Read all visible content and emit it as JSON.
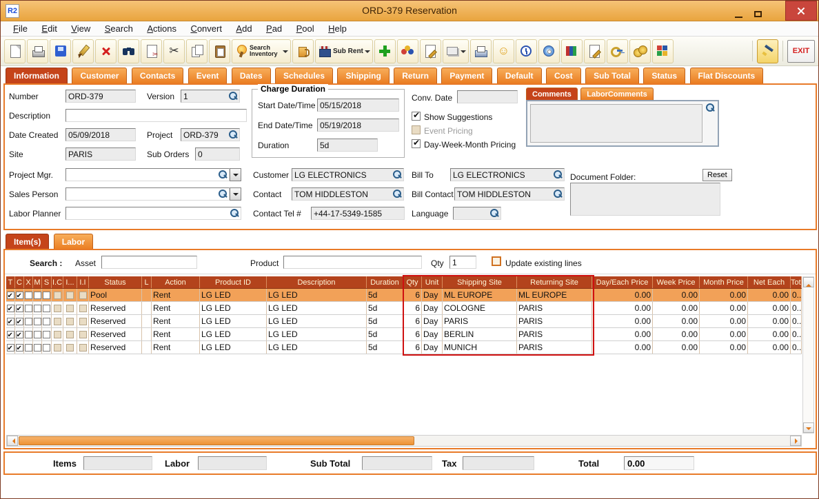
{
  "window": {
    "title": "ORD-379 Reservation",
    "app_initials": "R2"
  },
  "menu": {
    "items": [
      "File",
      "Edit",
      "View",
      "Search",
      "Actions",
      "Convert",
      "Add",
      "Pad",
      "Pool",
      "Help"
    ]
  },
  "toolbar": {
    "search_inventory": "Search Inventory",
    "sub_rent": "Sub Rent",
    "exit": "EXIT"
  },
  "icons": {
    "scissors": "✂",
    "smiley": "☺"
  },
  "tabs": [
    "Information",
    "Customer",
    "Contacts",
    "Event",
    "Dates",
    "Schedules",
    "Shipping",
    "Return",
    "Payment",
    "Default",
    "Cost",
    "Sub Total",
    "Status",
    "Flat Discounts"
  ],
  "info": {
    "labels": {
      "number": "Number",
      "version": "Version",
      "description": "Description",
      "date_created": "Date Created",
      "project": "Project",
      "site": "Site",
      "sub_orders": "Sub Orders",
      "project_mgr": "Project Mgr.",
      "sales_person": "Sales Person",
      "labor_planner": "Labor Planner",
      "charge_duration": "Charge Duration",
      "start": "Start Date/Time",
      "end": "End Date/Time",
      "duration": "Duration",
      "conv_date": "Conv. Date",
      "show_suggestions": "Show Suggestions",
      "event_pricing": "Event Pricing",
      "dwm_pricing": "Day-Week-Month Pricing",
      "customer": "Customer",
      "bill_to": "Bill To",
      "contact": "Contact",
      "bill_contact": "Bill Contact",
      "contact_tel": "Contact Tel #",
      "language": "Language",
      "document_folder": "Document Folder:",
      "reset": "Reset"
    },
    "values": {
      "number": "ORD-379",
      "version": "1",
      "description": "",
      "date_created": "05/09/2018",
      "project": "ORD-379",
      "site": "PARIS",
      "sub_orders": "0",
      "start": "05/15/2018",
      "end": "05/19/2018",
      "duration": "5d",
      "conv_date": "",
      "customer": "LG ELECTRONICS",
      "bill_to": "LG ELECTRONICS",
      "contact": "TOM HIDDLESTON",
      "bill_contact": "TOM HIDDLESTON",
      "contact_tel": "+44-17-5349-1585",
      "language": ""
    },
    "comments_tabs": [
      "Comments",
      "LaborComments"
    ]
  },
  "items": {
    "tabs": [
      "Item(s)",
      "Labor"
    ],
    "search_label": "Search :",
    "asset_label": "Asset",
    "product_label": "Product",
    "qty_label": "Qty",
    "qty_value": "1",
    "update_label": "Update existing lines"
  },
  "grid": {
    "columns": [
      "T",
      "C",
      "X",
      "M",
      "S",
      "I.C",
      "I...",
      "I.I",
      "Status",
      "L",
      "Action",
      "Product ID",
      "Description",
      "Duration",
      "Qty",
      "Unit",
      "Shipping Site",
      "Returning Site",
      "Day/Each Price",
      "Week Price",
      "Month Price",
      "Net Each",
      "Tot..."
    ],
    "rows": [
      {
        "status": "Pool",
        "action": "Rent",
        "product_id": "LG LED",
        "description": "LG LED",
        "duration": "5d",
        "qty": "6",
        "unit": "Day",
        "shipping_site": "ML EUROPE",
        "returning_site": "ML EUROPE",
        "day_each_price": "0.00",
        "week_price": "0.00",
        "month_price": "0.00",
        "net_each": "0.00",
        "tot": "0..."
      },
      {
        "status": "Reserved",
        "action": "Rent",
        "product_id": "LG LED",
        "description": "LG LED",
        "duration": "5d",
        "qty": "6",
        "unit": "Day",
        "shipping_site": "COLOGNE",
        "returning_site": "PARIS",
        "day_each_price": "0.00",
        "week_price": "0.00",
        "month_price": "0.00",
        "net_each": "0.00",
        "tot": "0..."
      },
      {
        "status": "Reserved",
        "action": "Rent",
        "product_id": "LG LED",
        "description": "LG LED",
        "duration": "5d",
        "qty": "6",
        "unit": "Day",
        "shipping_site": "PARIS",
        "returning_site": "PARIS",
        "day_each_price": "0.00",
        "week_price": "0.00",
        "month_price": "0.00",
        "net_each": "0.00",
        "tot": "0..."
      },
      {
        "status": "Reserved",
        "action": "Rent",
        "product_id": "LG LED",
        "description": "LG LED",
        "duration": "5d",
        "qty": "6",
        "unit": "Day",
        "shipping_site": "BERLIN",
        "returning_site": "PARIS",
        "day_each_price": "0.00",
        "week_price": "0.00",
        "month_price": "0.00",
        "net_each": "0.00",
        "tot": "0..."
      },
      {
        "status": "Reserved",
        "action": "Rent",
        "product_id": "LG LED",
        "description": "LG LED",
        "duration": "5d",
        "qty": "6",
        "unit": "Day",
        "shipping_site": "MUNICH",
        "returning_site": "PARIS",
        "day_each_price": "0.00",
        "week_price": "0.00",
        "month_price": "0.00",
        "net_each": "0.00",
        "tot": "0..."
      }
    ]
  },
  "footer": {
    "items_label": "Items",
    "items_value": "",
    "labor_label": "Labor",
    "labor_value": "",
    "sub_total_label": "Sub Total",
    "sub_total_value": "",
    "tax_label": "Tax",
    "tax_value": "",
    "total_label": "Total",
    "total_value": "0.00"
  }
}
